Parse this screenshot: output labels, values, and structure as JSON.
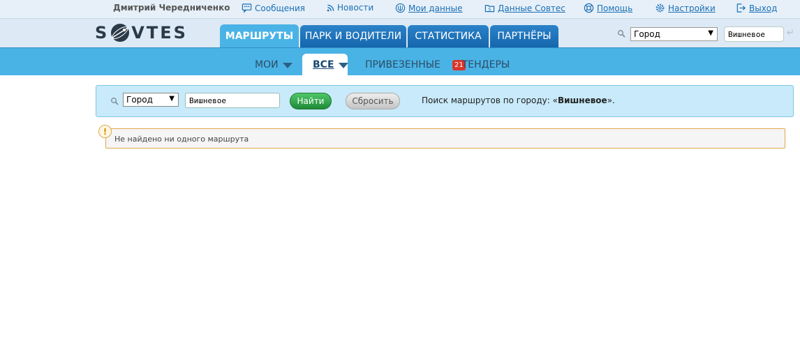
{
  "user": {
    "name": "Дмитрий Чередниченко"
  },
  "toplinks": [
    {
      "label": "Сообщения",
      "icon": "messages-icon"
    },
    {
      "label": "Новости",
      "icon": "rss-icon"
    },
    {
      "label": "Мои данные",
      "icon": "emblem-icon"
    },
    {
      "label": "Данные Совтес",
      "icon": "folder-icon"
    },
    {
      "label": "Помощь",
      "icon": "lifebuoy-icon"
    },
    {
      "label": "Настройки",
      "icon": "gear-icon"
    },
    {
      "label": "Выход",
      "icon": "logout-icon"
    }
  ],
  "logo": {
    "left": "S",
    "right": "VTES"
  },
  "main_tabs": [
    "МАРШРУТЫ",
    "ПАРК И ВОДИТЕЛИ",
    "СТАТИСТИКА",
    "ПАРТНЁРЫ"
  ],
  "header_search": {
    "select_value": "Город",
    "input_value": "Вишневое",
    "enter_glyph": "↵"
  },
  "sub_tabs": {
    "my": "МОИ",
    "all": "ВСЕ",
    "attached": "ПРИВЕЗЕННЫЕ",
    "tenders": "ТЕНДЕРЫ",
    "tenders_badge": "21"
  },
  "search": {
    "select_value": "Город",
    "input_value": "Вишневое",
    "find_label": "Найти",
    "reset_label": "Сбросить",
    "result_prefix": "Поиск маршрутов по городу: «",
    "result_city": "Вишневое",
    "result_suffix": "»."
  },
  "notice": {
    "icon_glyph": "!",
    "text": "Не найдено ни одного маршрута"
  },
  "colors": {
    "accent": "#4ab3e6",
    "tab_dark": "#1566ad",
    "link": "#1a6fb5",
    "badge": "#d9352b"
  }
}
